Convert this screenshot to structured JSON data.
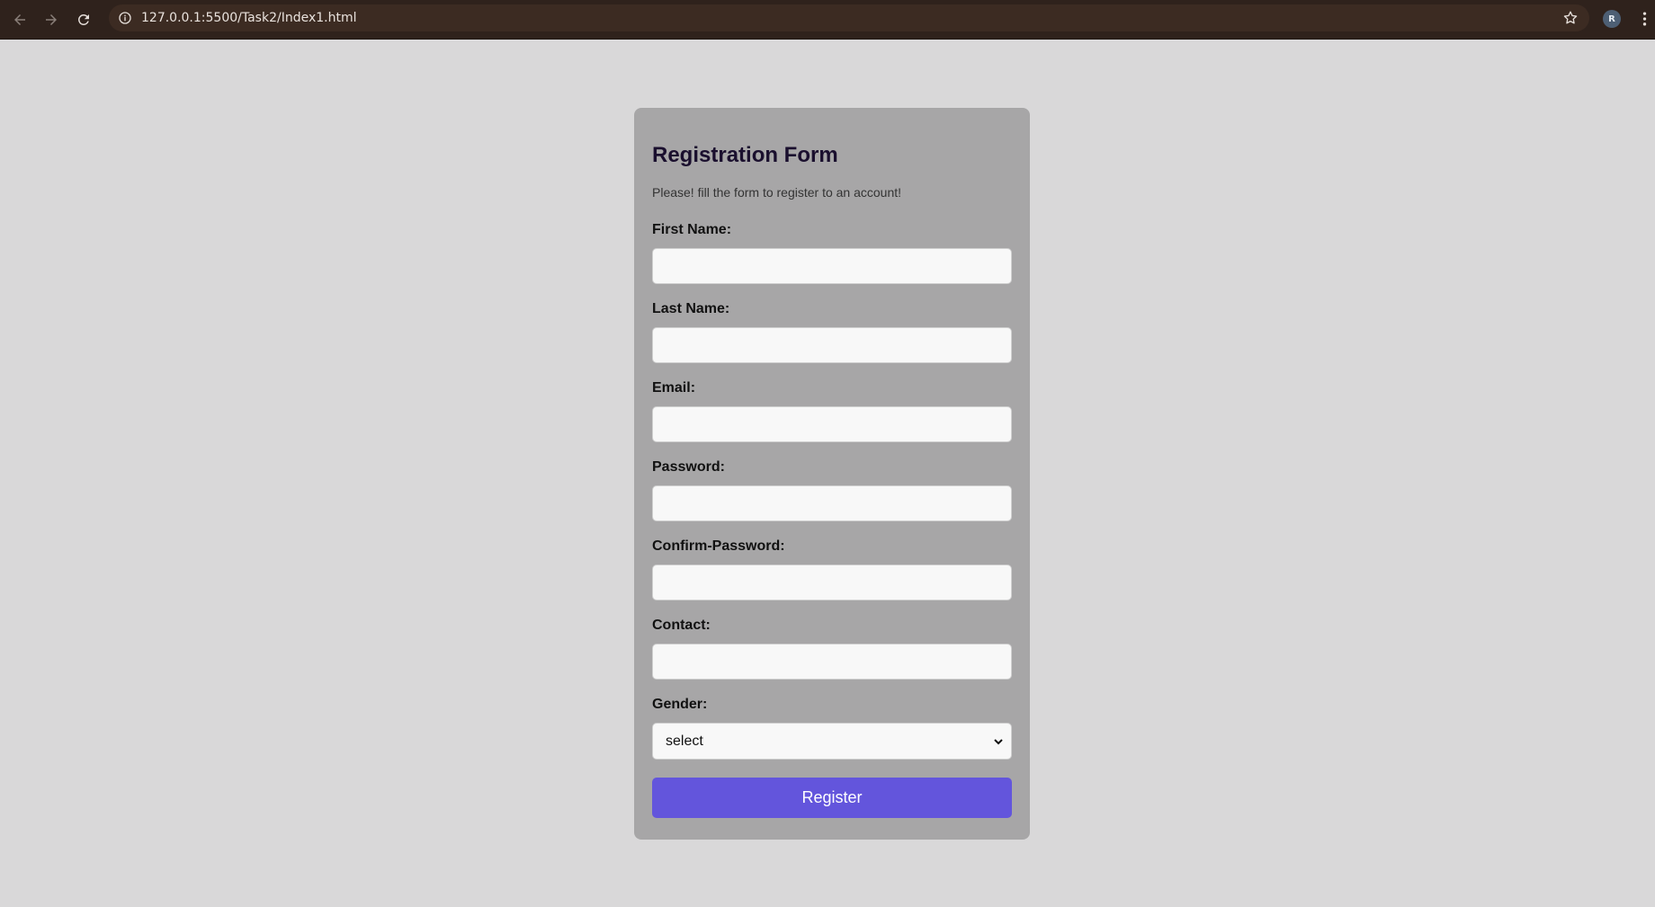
{
  "browser": {
    "url": "127.0.0.1:5500/Task2/Index1.html",
    "profile_initial": "R",
    "icons": [
      "back-arrow-icon",
      "forward-arrow-icon",
      "reload-icon",
      "info-icon",
      "star-icon",
      "kebab-menu-icon"
    ]
  },
  "form": {
    "title": "Registration Form",
    "subtitle": "Please! fill the form to register to an account!",
    "fields": [
      {
        "label": "First Name:",
        "value": ""
      },
      {
        "label": "Last Name:",
        "value": ""
      },
      {
        "label": "Email:",
        "value": ""
      },
      {
        "label": "Password:",
        "value": ""
      },
      {
        "label": "Confirm-Password:",
        "value": ""
      },
      {
        "label": "Contact:",
        "value": ""
      }
    ],
    "gender": {
      "label": "Gender:",
      "selected": "select"
    },
    "submit_label": "Register"
  },
  "colors": {
    "page_background": "#d9d8d9",
    "card_background": "#a7a6a7",
    "button_background": "#6355dc",
    "browser_bar": "#2f221c"
  }
}
